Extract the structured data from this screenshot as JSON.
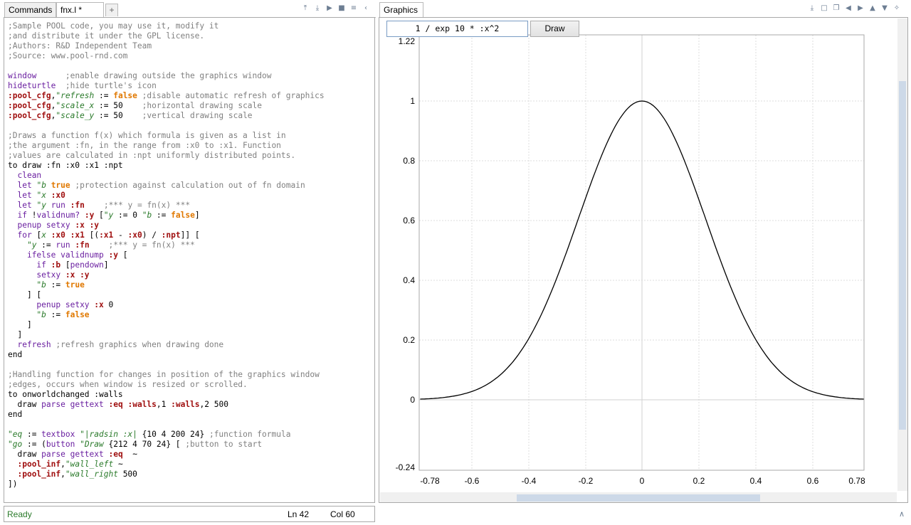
{
  "left_panel": {
    "tabs": [
      {
        "label": "Commands"
      },
      {
        "label": "fnx.l *"
      },
      {
        "label": "+"
      }
    ]
  },
  "right_panel": {
    "tab": {
      "label": "Graphics"
    }
  },
  "graphics": {
    "formula_value": "1 / exp 10 * :x^2",
    "draw_button_label": "Draw"
  },
  "status": {
    "state": "Ready",
    "line": "Ln 42",
    "col": "Col 60"
  },
  "editor": {
    "lines": [
      [
        [
          "c",
          ";Sample POOL code, you may use it, modify it"
        ]
      ],
      [
        [
          "c",
          ";and distribute it under the GPL license."
        ]
      ],
      [
        [
          "c",
          ";Authors: R&D Independent Team"
        ]
      ],
      [
        [
          "c",
          ";Source: www.pool-rnd.com"
        ]
      ],
      [],
      [
        [
          "k",
          "window"
        ],
        [
          "",
          "      "
        ],
        [
          "c",
          ";enable drawing outside the graphics window"
        ]
      ],
      [
        [
          "k",
          "hideturtle"
        ],
        [
          "",
          "  "
        ],
        [
          "c",
          ";hide turtle's icon"
        ]
      ],
      [
        [
          "v",
          ":pool_cfg"
        ],
        [
          "",
          ","
        ],
        [
          "s",
          "\"refresh"
        ],
        [
          "",
          " := "
        ],
        [
          "o",
          "false"
        ],
        [
          "",
          " "
        ],
        [
          "c",
          ";disable automatic refresh of graphics"
        ]
      ],
      [
        [
          "v",
          ":pool_cfg"
        ],
        [
          "",
          ","
        ],
        [
          "s",
          "\"scale_x"
        ],
        [
          "",
          " := 50    "
        ],
        [
          "c",
          ";horizontal drawing scale"
        ]
      ],
      [
        [
          "v",
          ":pool_cfg"
        ],
        [
          "",
          ","
        ],
        [
          "s",
          "\"scale_y"
        ],
        [
          "",
          " := 50    "
        ],
        [
          "c",
          ";vertical drawing scale"
        ]
      ],
      [],
      [
        [
          "c",
          ";Draws a function f(x) which formula is given as a list in"
        ]
      ],
      [
        [
          "c",
          ";the argument :fn, in the range from :x0 to :x1. Function"
        ]
      ],
      [
        [
          "c",
          ";values are calculated in :npt uniformly distributed points."
        ]
      ],
      [
        [
          "",
          "to draw :fn :x0 :x1 :npt"
        ]
      ],
      [
        [
          "",
          "  "
        ],
        [
          "k",
          "clean"
        ]
      ],
      [
        [
          "",
          "  "
        ],
        [
          "k",
          "let"
        ],
        [
          "",
          ""
        ],
        [
          "",
          " "
        ],
        [
          "s",
          "\"b"
        ],
        [
          "",
          " "
        ],
        [
          "o",
          "true"
        ],
        [
          "",
          " "
        ],
        [
          "c",
          ";protection against calculation out of fn domain"
        ]
      ],
      [
        [
          "",
          "  "
        ],
        [
          "k",
          "let"
        ],
        [
          "",
          " "
        ],
        [
          "s",
          "\"x"
        ],
        [
          "",
          " "
        ],
        [
          "v",
          ":x0"
        ]
      ],
      [
        [
          "",
          "  "
        ],
        [
          "k",
          "let"
        ],
        [
          "",
          " "
        ],
        [
          "s",
          "\"y"
        ],
        [
          "",
          " "
        ],
        [
          "k",
          "run"
        ],
        [
          "",
          " "
        ],
        [
          "v",
          ":fn"
        ],
        [
          "",
          "    "
        ],
        [
          "c",
          ";*** y = fn(x) ***"
        ]
      ],
      [
        [
          "",
          "  "
        ],
        [
          "k",
          "if"
        ],
        [
          "",
          " !"
        ],
        [
          "k",
          "validnum?"
        ],
        [
          "",
          " "
        ],
        [
          "v",
          ":y"
        ],
        [
          "",
          " ["
        ],
        [
          "s",
          "\"y"
        ],
        [
          "",
          " := 0 "
        ],
        [
          "s",
          "\"b"
        ],
        [
          "",
          " := "
        ],
        [
          "o",
          "false"
        ],
        [
          "",
          "]"
        ]
      ],
      [
        [
          "",
          "  "
        ],
        [
          "k",
          "penup"
        ],
        [
          "",
          " "
        ],
        [
          "k",
          "setxy"
        ],
        [
          "",
          " "
        ],
        [
          "v",
          ":x :y"
        ]
      ],
      [
        [
          "",
          "  "
        ],
        [
          "k",
          "for"
        ],
        [
          "",
          " ["
        ],
        [
          "s",
          "x"
        ],
        [
          "",
          " "
        ],
        [
          "v",
          ":x0 :x1"
        ],
        [
          "",
          " [("
        ],
        [
          "v",
          ":x1"
        ],
        [
          "",
          " - "
        ],
        [
          "v",
          ":x0"
        ],
        [
          "",
          ") / "
        ],
        [
          "v",
          ":npt"
        ],
        [
          "",
          "]] ["
        ]
      ],
      [
        [
          "",
          "    "
        ],
        [
          "s",
          "\"y"
        ],
        [
          "",
          " := "
        ],
        [
          "k",
          "run"
        ],
        [
          "",
          " "
        ],
        [
          "v",
          ":fn"
        ],
        [
          "",
          "    "
        ],
        [
          "c",
          ";*** y = fn(x) ***"
        ]
      ],
      [
        [
          "",
          "    "
        ],
        [
          "k",
          "ifelse"
        ],
        [
          "",
          " "
        ],
        [
          "k",
          "validnump"
        ],
        [
          "",
          " "
        ],
        [
          "v",
          ":y"
        ],
        [
          "",
          " ["
        ]
      ],
      [
        [
          "",
          "      "
        ],
        [
          "k",
          "if"
        ],
        [
          "",
          " "
        ],
        [
          "v",
          ":b"
        ],
        [
          "",
          " ["
        ],
        [
          "k",
          "pendown"
        ],
        [
          "",
          "]"
        ]
      ],
      [
        [
          "",
          "      "
        ],
        [
          "k",
          "setxy"
        ],
        [
          "",
          " "
        ],
        [
          "v",
          ":x :y"
        ]
      ],
      [
        [
          "",
          "      "
        ],
        [
          "s",
          "\"b"
        ],
        [
          "",
          " := "
        ],
        [
          "o",
          "true"
        ]
      ],
      [
        [
          "",
          "    ] ["
        ]
      ],
      [
        [
          "",
          "      "
        ],
        [
          "k",
          "penup"
        ],
        [
          "",
          " "
        ],
        [
          "k",
          "setxy"
        ],
        [
          "",
          " "
        ],
        [
          "v",
          ":x"
        ],
        [
          "",
          " 0"
        ]
      ],
      [
        [
          "",
          "      "
        ],
        [
          "s",
          "\"b"
        ],
        [
          "",
          " := "
        ],
        [
          "o",
          "false"
        ]
      ],
      [
        [
          "",
          "    ]"
        ]
      ],
      [
        [
          "",
          "  ]"
        ]
      ],
      [
        [
          "",
          "  "
        ],
        [
          "k",
          "refresh"
        ],
        [
          "",
          " "
        ],
        [
          "c",
          ";refresh graphics when drawing done"
        ]
      ],
      [
        [
          "",
          "end"
        ]
      ],
      [],
      [
        [
          "c",
          ";Handling function for changes in position of the graphics window"
        ]
      ],
      [
        [
          "c",
          ";edges, occurs when window is resized or scrolled."
        ]
      ],
      [
        [
          "",
          "to onworldchanged :walls"
        ]
      ],
      [
        [
          "",
          "  draw "
        ],
        [
          "k",
          "parse"
        ],
        [
          "",
          " "
        ],
        [
          "k",
          "gettext"
        ],
        [
          "",
          " "
        ],
        [
          "v",
          ":eq"
        ],
        [
          "",
          " "
        ],
        [
          "v",
          ":walls"
        ],
        [
          "",
          ",1 "
        ],
        [
          "v",
          ":walls"
        ],
        [
          "",
          ",2 500"
        ]
      ],
      [
        [
          "",
          "end"
        ]
      ],
      [],
      [
        [
          "s",
          "\"eq"
        ],
        [
          "",
          " := "
        ],
        [
          "k",
          "textbox"
        ],
        [
          "",
          " "
        ],
        [
          "s",
          "\"|radsin :x|"
        ],
        [
          "",
          " {10 4 200 24} "
        ],
        [
          "c",
          ";function formula"
        ]
      ],
      [
        [
          "s",
          "\"go"
        ],
        [
          "",
          " := ("
        ],
        [
          "k",
          "button"
        ],
        [
          "",
          " "
        ],
        [
          "s",
          "\"Draw"
        ],
        [
          "",
          " {212 4 70 24} [ "
        ],
        [
          "c",
          ";button to start"
        ]
      ],
      [
        [
          "",
          "  draw "
        ],
        [
          "k",
          "parse"
        ],
        [
          "",
          " "
        ],
        [
          "k",
          "gettext"
        ],
        [
          "",
          " "
        ],
        [
          "v",
          ":eq"
        ],
        [
          "",
          "  ~"
        ]
      ],
      [
        [
          "",
          "  "
        ],
        [
          "v",
          ":pool_inf"
        ],
        [
          "",
          ","
        ],
        [
          "s",
          "\"wall_left"
        ],
        [
          "",
          " ~"
        ]
      ],
      [
        [
          "",
          "  "
        ],
        [
          "v",
          ":pool_inf"
        ],
        [
          "",
          ","
        ],
        [
          "s",
          "\"wall_right"
        ],
        [
          "",
          " 500"
        ]
      ],
      [
        [
          "",
          "])"
        ]
      ]
    ]
  },
  "chart_data": {
    "type": "line",
    "title": "",
    "xlabel": "",
    "ylabel": "",
    "xlim": [
      -0.78,
      0.78
    ],
    "ylim": [
      -0.24,
      1.22
    ],
    "x_ticks": [
      "-0.78",
      "-0.6",
      "-0.4",
      "-0.2",
      "0",
      "0.2",
      "0.4",
      "0.6",
      "0.78"
    ],
    "y_ticks": [
      "1.22",
      "1",
      "0.8",
      "0.6",
      "0.4",
      "0.2",
      "0",
      "-0.24"
    ],
    "grid": true,
    "series": [
      {
        "x": [
          -0.78,
          -0.7,
          -0.6,
          -0.5,
          -0.4,
          -0.3,
          -0.2,
          -0.1,
          0,
          0.1,
          0.2,
          0.3,
          0.4,
          0.5,
          0.6,
          0.7,
          0.78
        ],
        "y": [
          0.002,
          0.007,
          0.027,
          0.082,
          0.202,
          0.407,
          0.67,
          0.905,
          1.0,
          0.905,
          0.67,
          0.407,
          0.202,
          0.082,
          0.027,
          0.007,
          0.002
        ],
        "color": "#000000"
      }
    ]
  }
}
